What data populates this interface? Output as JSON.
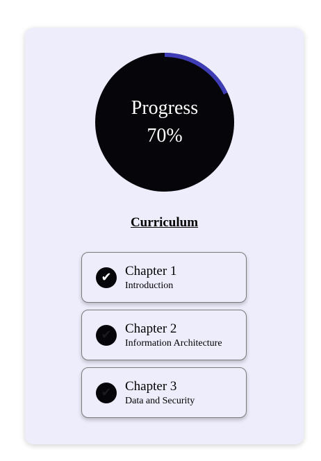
{
  "progress": {
    "label": "Progress",
    "percent_text": "70%",
    "fraction": 0.18,
    "ring_color": "#3f3db5",
    "track_color": "#05050a"
  },
  "curriculum": {
    "title": "Curriculum",
    "chapters": [
      {
        "title": "Chapter 1",
        "subtitle": "Introduction",
        "status_icon": "checkmark-icon",
        "completed": true
      },
      {
        "title": "Chapter 2",
        "subtitle": "Information Architecture",
        "status_icon": "pending-icon",
        "completed": false
      },
      {
        "title": "Chapter 3",
        "subtitle": "Data and Security",
        "status_icon": "pending-icon",
        "completed": false
      }
    ]
  },
  "colors": {
    "card_background": "#eeedfb",
    "accent": "#3f3db5"
  }
}
